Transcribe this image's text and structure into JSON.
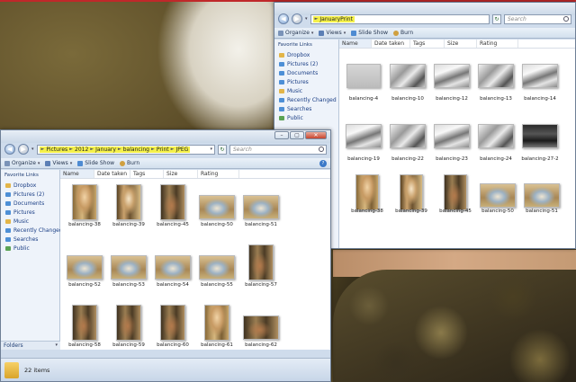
{
  "window_a": {
    "address_path": [
      "JanuaryPrint"
    ],
    "search_placeholder": "Search",
    "toolbar": {
      "organize": "Organize",
      "views": "Views",
      "slideshow": "Slide Show",
      "burn": "Burn"
    },
    "favorites_header": "Favorite Links",
    "favorites": [
      "Dropbox",
      "Pictures (2)",
      "Documents",
      "Pictures",
      "Music",
      "Recently Changed",
      "Searches",
      "Public"
    ],
    "columns": [
      "Name",
      "Date taken",
      "Tags",
      "Size",
      "Rating"
    ],
    "files": [
      "balancing-4",
      "balancing-10",
      "balancing-12",
      "balancing-13",
      "balancing-14",
      "balancing-19",
      "balancing-22",
      "balancing-23",
      "balancing-24",
      "balancing-27-2",
      "balancing-38",
      "balancing-39",
      "balancing-45",
      "balancing-50",
      "balancing-51"
    ]
  },
  "window_b": {
    "address_path": [
      "Pictures",
      "2012",
      "January",
      "balancing",
      "Print",
      "JPEG"
    ],
    "search_placeholder": "Search",
    "toolbar": {
      "organize": "Organize",
      "views": "Views",
      "slideshow": "Slide Show",
      "burn": "Burn"
    },
    "favorites_header": "Favorite Links",
    "favorites": [
      "Dropbox",
      "Pictures (2)",
      "Documents",
      "Pictures",
      "Music",
      "Recently Changed",
      "Searches",
      "Public"
    ],
    "folders_label": "Folders",
    "columns": [
      "Name",
      "Date taken",
      "Tags",
      "Size",
      "Rating"
    ],
    "files": [
      "balancing-38",
      "balancing-39",
      "balancing-45",
      "balancing-50",
      "balancing-51",
      "balancing-52",
      "balancing-53",
      "balancing-54",
      "balancing-55",
      "balancing-57",
      "balancing-58",
      "balancing-59",
      "balancing-60",
      "balancing-61",
      "balancing-62"
    ],
    "status": "22 items"
  },
  "window_buttons": {
    "minimize": "–",
    "maximize": "▢",
    "close": "✕"
  },
  "icons": {
    "back": "◀",
    "forward": "▶",
    "refresh": "↻",
    "dropdown": "▾",
    "separator": "►",
    "help": "?"
  },
  "colors": {
    "highlight": "#f4f04a",
    "link": "#1a3e85",
    "chrome": "#cfdcec"
  }
}
